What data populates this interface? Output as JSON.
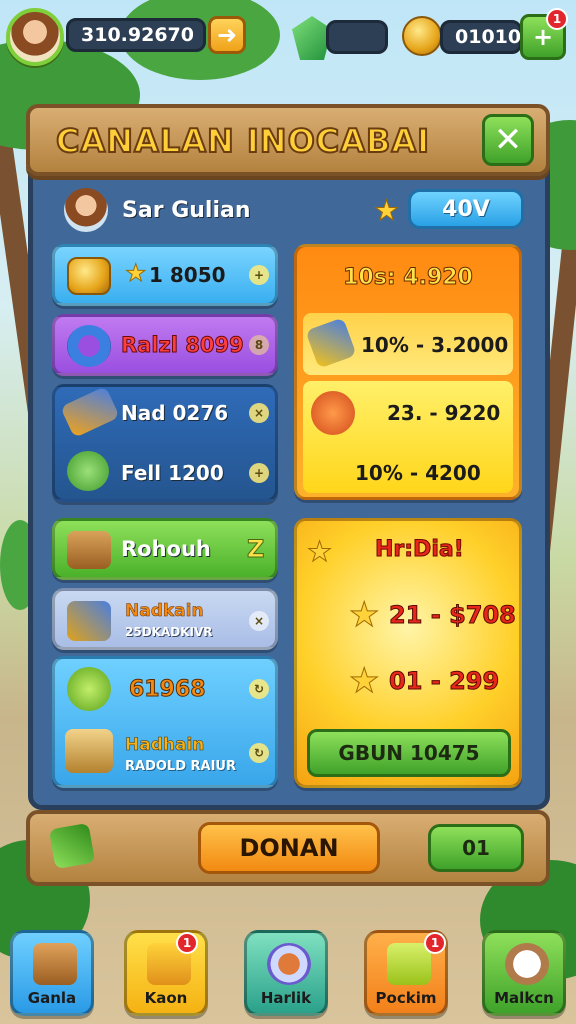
{
  "topbar": {
    "coins_value": "310.92670",
    "gold_value": "01010"
  },
  "panel": {
    "title": "CANALAN INOCABAI",
    "close_label": "✕",
    "user_name": "Sar Gulian",
    "level_value": "40V"
  },
  "left_cards": {
    "card1_value": "1 8050",
    "card2_label": "Ralzl 8099",
    "card3_label": "Nad 0276",
    "card3b_label": "Fell 1200",
    "card4_label": "Rohouh",
    "card4_badge": "Z",
    "card5_title": "Nadkain",
    "card5_sub": "25DKADKIVR",
    "card6_value": "61968",
    "card6b_title": "Hadhain",
    "card6b_sub": "RADOLD RAIUR"
  },
  "right_cards": {
    "orange_header": "10s: 4.920",
    "row1": "10% - 3.2000",
    "row2": "23. - 9220",
    "row3": "10% - 4200",
    "promo_title": "Hr:Dia!",
    "promo_row1": "21 - $708",
    "promo_row2": "01 - 299",
    "promo_button": "GBUN 10475"
  },
  "bottom": {
    "main_button": "DONAN",
    "count_button": "01"
  },
  "nav": [
    {
      "label": "Ganla"
    },
    {
      "label": "Kaon",
      "badge": "1"
    },
    {
      "label": "Harlik"
    },
    {
      "label": "Pockim",
      "badge": "1"
    },
    {
      "label": "Malkcn"
    }
  ],
  "topbar_badge": "1",
  "colors": {
    "panel": "#40699a",
    "wood": "#c4934f",
    "green": "#5bbf36",
    "orange": "#f7941d",
    "yellow": "#ffd23a",
    "purple": "#a45ce0",
    "blue": "#3aaff0"
  }
}
